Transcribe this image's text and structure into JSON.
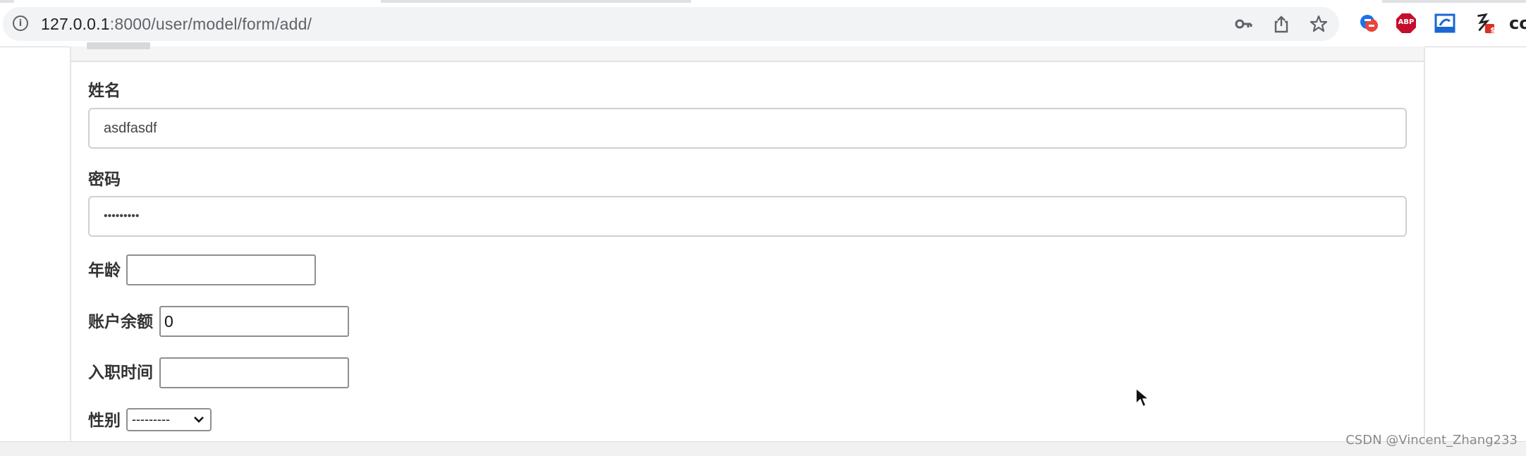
{
  "browser": {
    "url_host": "127.0.0.1",
    "url_path": ":8000/user/model/form/add/",
    "extensions": [
      "translate-extension-icon",
      "adblock-plus-icon",
      "scribe-extension-icon",
      "timer-extension-icon",
      "coinbase-extension-icon"
    ],
    "ext_badge": "$",
    "abp_text": "ABP",
    "co_text": "co"
  },
  "form": {
    "name": {
      "label": "姓名",
      "value": "asdfasdf"
    },
    "password": {
      "label": "密码",
      "value": "asdfasdfa"
    },
    "age": {
      "label": "年龄",
      "value": ""
    },
    "balance": {
      "label": "账户余额",
      "value": "0"
    },
    "create_time": {
      "label": "入职时间",
      "value": ""
    },
    "gender": {
      "label": "性别",
      "selected": "---------"
    }
  },
  "watermark": "CSDN @Vincent_Zhang233",
  "colors": {
    "omnibox_bg": "#f1f3f4",
    "input_border": "#d0d0d0",
    "label": "#333333"
  }
}
